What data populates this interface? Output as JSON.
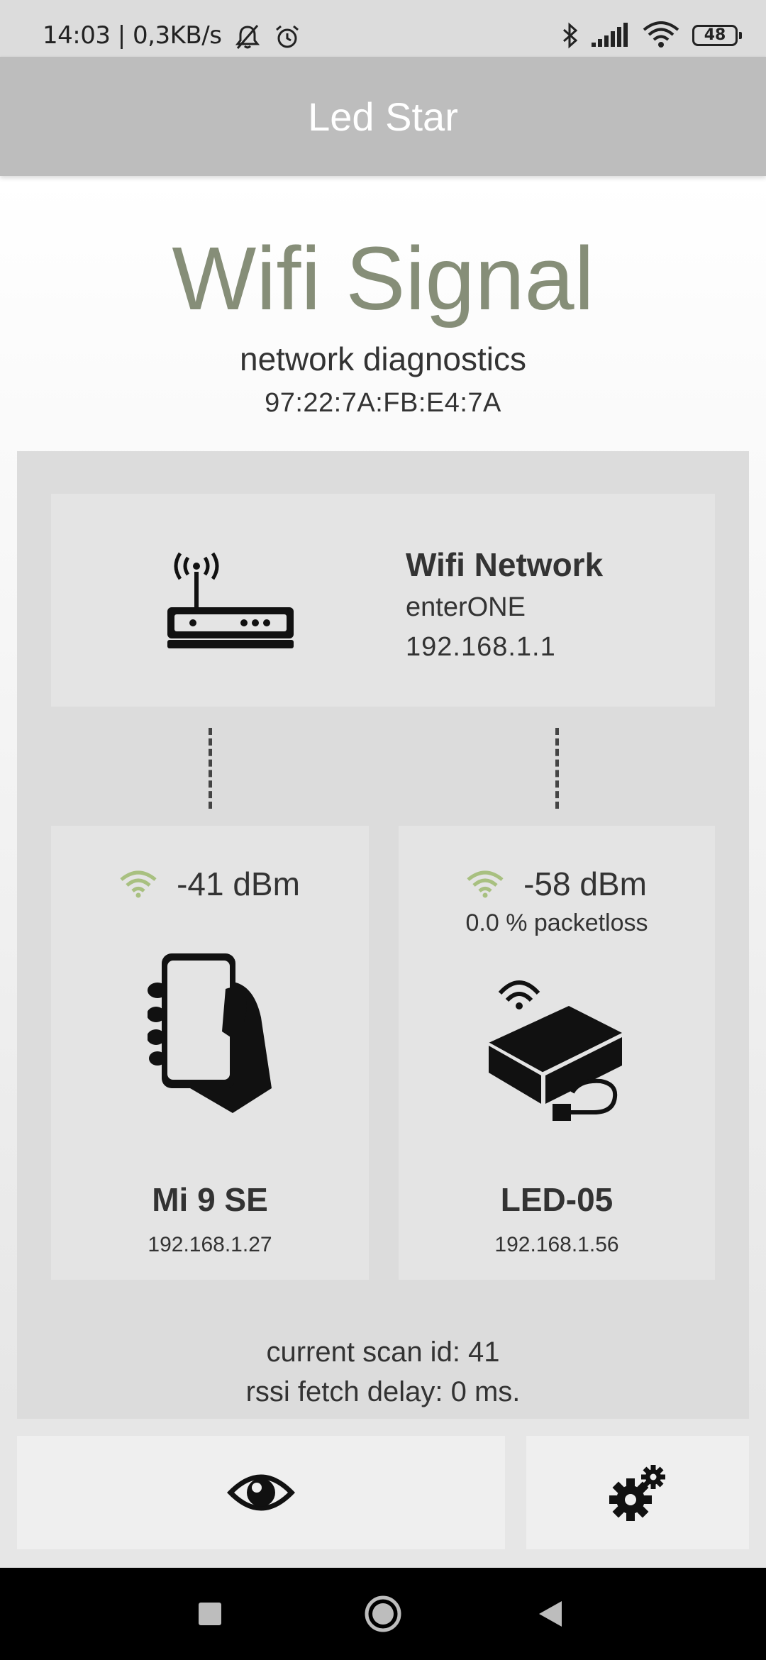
{
  "status_bar": {
    "time_speed": "14:03 | 0,3KB/s",
    "battery": "48",
    "icons": [
      "mute-icon",
      "alarm-icon",
      "bluetooth-icon",
      "cell-signal-icon",
      "wifi-icon",
      "battery-icon"
    ]
  },
  "app_bar": {
    "title": "Led Star"
  },
  "header": {
    "title": "Wifi Signal",
    "subtitle": "network diagnostics",
    "mac": "97:22:7A:FB:E4:7A"
  },
  "router": {
    "label": "Wifi Network",
    "ssid": "enterONE",
    "ip": "192.168.1.1",
    "icon": "router-icon"
  },
  "phone_device": {
    "signal": "-41 dBm",
    "name": "Mi 9 SE",
    "ip": "192.168.1.27",
    "icon": "phone-in-hand-icon"
  },
  "led_device": {
    "signal": "-58 dBm",
    "packetloss": "0.0 % packetloss",
    "name": "LED-05",
    "ip": "192.168.1.56",
    "icon": "wifi-box-icon"
  },
  "scan": {
    "scan_id": "current scan id: 41",
    "fetch_delay": "rssi fetch delay: 0 ms."
  },
  "buttons": [
    "eye-icon",
    "gear-icon"
  ],
  "colors": {
    "title_green": "#868e78",
    "wifi_green": "#a8c080",
    "app_bar": "#bdbdbd",
    "panel": "#dcdcdc",
    "card": "#e4e4e4"
  }
}
